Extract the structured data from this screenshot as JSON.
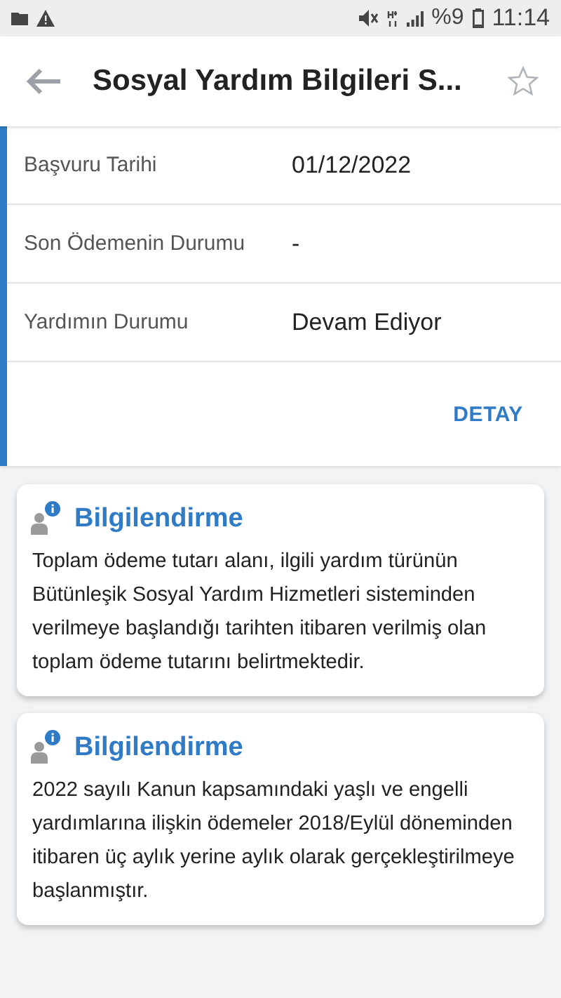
{
  "status_bar": {
    "battery": "%9",
    "time": "11:14"
  },
  "header": {
    "title": "Sosyal Yardım Bilgileri S..."
  },
  "details": {
    "rows": [
      {
        "label": "Başvuru Tarihi",
        "value": "01/12/2022"
      },
      {
        "label": "Son Ödemenin Durumu",
        "value": "-"
      },
      {
        "label": "Yardımın Durumu",
        "value": "Devam Ediyor"
      }
    ],
    "action": "DETAY"
  },
  "info_cards": [
    {
      "title": "Bilgilendirme",
      "text": "Toplam ödeme tutarı alanı, ilgili yardım türünün Bütünleşik Sosyal Yardım Hizmetleri sisteminden verilmeye başlandığı tarihten itibaren verilmiş olan toplam ödeme tutarını belirtmektedir."
    },
    {
      "title": "Bilgilendirme",
      "text": "2022 sayılı Kanun kapsamındaki yaşlı ve engelli yardımlarına ilişkin ödemeler 2018/Eylül döneminden itibaren üç aylık yerine aylık olarak gerçekleştirilmeye başlanmıştır."
    }
  ]
}
